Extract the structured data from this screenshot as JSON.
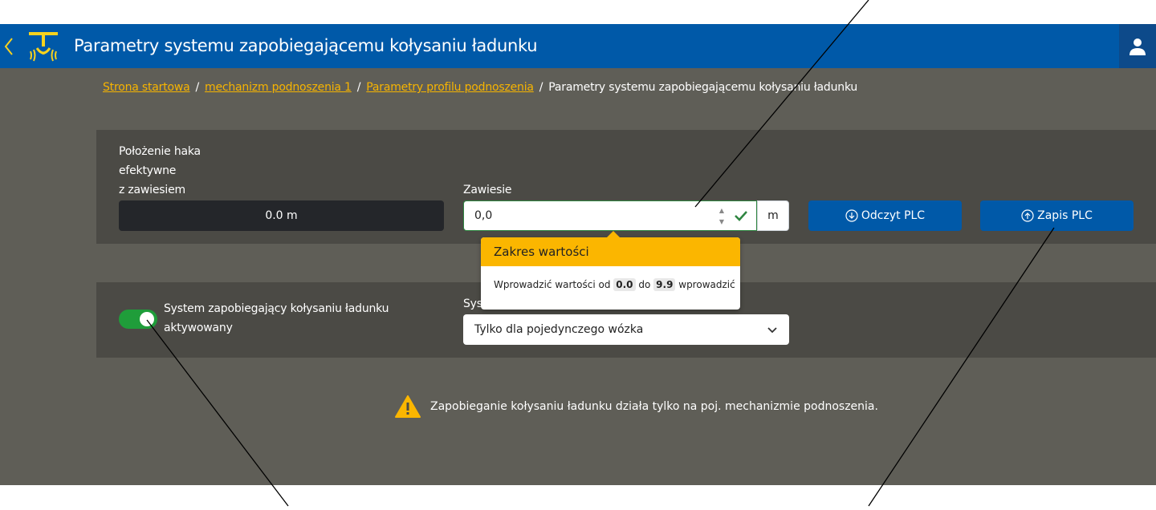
{
  "header": {
    "title": "Parametry systemu zapobiegającemu kołysaniu ładunku",
    "colors": {
      "bar": "#0059a8",
      "accent": "#f7d21e"
    }
  },
  "breadcrumb": {
    "items": [
      "Strona startowa",
      "mechanizm podnoszenia 1",
      "Parametry profilu podnoszenia"
    ],
    "current": "Parametry systemu zapobiegającemu kołysaniu ładunku",
    "separator": "/"
  },
  "card1": {
    "hook_label_line1": "Położenie haka",
    "hook_label_line2": "efektywne",
    "hook_label_line3": "z zawiesiem",
    "hook_value": "0.0 m",
    "sling_label": "Zawiesie",
    "sling_value": "0,0",
    "sling_unit": "m",
    "read_button": "Odczyt PLC",
    "write_button": "Zapis PLC"
  },
  "popover": {
    "title": "Zakres wartości",
    "text_before": "Wprowadzić wartości od",
    "min": "0.0",
    "text_mid": "do",
    "max": "9.9",
    "text_after": "wprowadzić"
  },
  "card2": {
    "toggle_label_line1": "System zapobiegający kołysaniu ładunku",
    "toggle_label_line2": "aktywowany",
    "toggle_on": true,
    "select_label_partial": "Sys",
    "select_value": "Tylko dla pojedynczego wózka"
  },
  "warning": {
    "text": "Zapobieganie kołysaniu ładunku działa tylko na poj. mechanizmie podnoszenia."
  }
}
